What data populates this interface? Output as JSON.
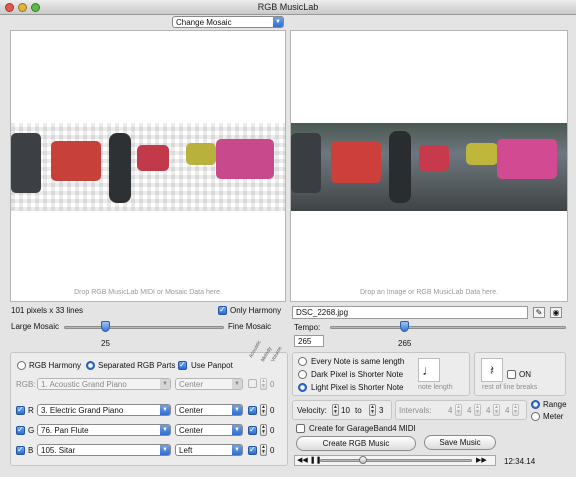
{
  "window": {
    "title": "RGB MusicLab"
  },
  "top": {
    "mosaic_dropdown": "Change Mosaic"
  },
  "left_panel": {
    "drop_note": "Drop RGB MusicLab MIDI or Mosaic Data here.",
    "resolution": "101 pixels x 33 lines",
    "only_harmony_label": "Only Harmony",
    "slider_left_label": "Large Mosaic",
    "slider_right_label": "Fine Mosaic",
    "slider_value": "25"
  },
  "right_panel": {
    "drop_note": "Drop an Image or RGB MusicLab Data here.",
    "filename": "DSC_2268.jpg",
    "tempo_label": "Tempo:",
    "tempo_value": "265",
    "tempo_slider_value": "265"
  },
  "mode": {
    "rgb_harmony": "RGB Harmony",
    "separated": "Separated RGB Parts",
    "use_panpot": "Use Panpot",
    "rgb_row_label": "RGB:",
    "rgb_instrument": "1. Acoustic Grand Piano",
    "rgb_pan": "Center",
    "col_acoustic": "Acoustic",
    "col_melody": "Melody",
    "col_volume": "Volume"
  },
  "channels": [
    {
      "letter": "R",
      "instrument": "3. Electric Grand Piano",
      "pan": "Center",
      "value": "0"
    },
    {
      "letter": "G",
      "instrument": "76. Pan Flute",
      "pan": "Center",
      "value": "0"
    },
    {
      "letter": "B",
      "instrument": "105. Sitar",
      "pan": "Left",
      "value": "0"
    }
  ],
  "rgb_row_value": "0",
  "note_options": {
    "every_note": "Every Note is same length",
    "dark_shorter": "Dark Pixel is Shorter Note",
    "light_shorter": "Light Pixel is Shorter Note",
    "note_length_label": "note length",
    "note_glyph": "♩",
    "on_label": "ON",
    "rest_label": "rest of line breaks",
    "rest_glyph": "𝄽"
  },
  "velocity": {
    "label": "Velocity:",
    "from": "10",
    "to_label": "to",
    "to": "3"
  },
  "intervals": {
    "label": "Intervals:",
    "values": [
      "4",
      "4",
      "4",
      "4"
    ]
  },
  "range_meter": {
    "range": "Range",
    "meter": "Meter"
  },
  "garageband": "Create for GarageBand4 MIDI",
  "buttons": {
    "create": "Create RGB Music",
    "save": "Save Music"
  },
  "player": {
    "time": "12:34.14",
    "progress": 0.28
  }
}
